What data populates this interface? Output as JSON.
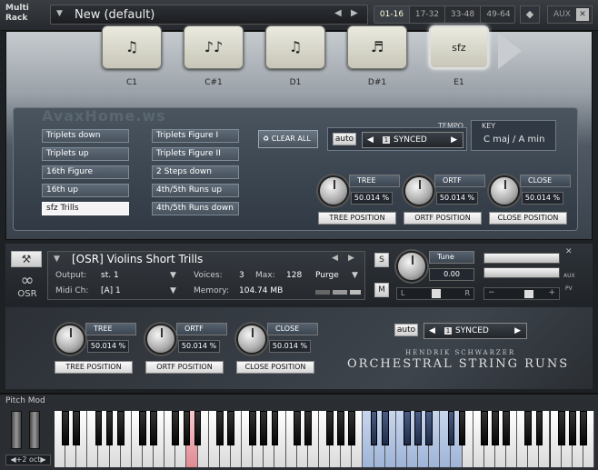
{
  "header": {
    "multi_rack": "Multi Rack",
    "preset_name": "New (default)",
    "tabs": [
      "01-16",
      "17-32",
      "33-48",
      "49-64"
    ],
    "active_tab": "01-16",
    "aux_label": "AUX"
  },
  "pads": [
    {
      "note": "C1",
      "symbol": "♫"
    },
    {
      "note": "C#1",
      "symbol": "♪♪"
    },
    {
      "note": "D1",
      "symbol": "♫"
    },
    {
      "note": "D#1",
      "symbol": "♬"
    },
    {
      "note": "E1",
      "symbol": "sfz"
    }
  ],
  "watermark": "AvaxHome.ws",
  "articulations": {
    "left": [
      "Triplets down",
      "Triplets up",
      "16th Figure",
      "16th up",
      "sfz Trills"
    ],
    "right": [
      "Triplets Figure I",
      "Triplets Figure II",
      "2 Steps down",
      "4th/5th Runs up",
      "4th/5th Runs down"
    ],
    "selected": "sfz Trills"
  },
  "clear_all": "CLEAR ALL",
  "tempo": {
    "label": "TEMPO",
    "auto": "auto",
    "sync_index": "1",
    "sync_value": "SYNCED"
  },
  "key": {
    "label": "KEY",
    "value": "C maj / A min"
  },
  "upper_mix": [
    {
      "name": "TREE",
      "value": "50.014 %",
      "button": "TREE POSITION"
    },
    {
      "name": "ORTF",
      "value": "50.014 %",
      "button": "ORTF POSITION"
    },
    {
      "name": "CLOSE",
      "value": "50.014 %",
      "button": "CLOSE POSITION"
    }
  ],
  "instrument": {
    "name": "[OSR] Violins Short Trills",
    "output_label": "Output:",
    "output_value": "st. 1",
    "voices_label": "Voices:",
    "voices_value": "3",
    "max_label": "Max:",
    "max_value": "128",
    "purge": "Purge",
    "midi_label": "Midi Ch:",
    "midi_value": "[A]  1",
    "memory_label": "Memory:",
    "memory_value": "104.74 MB",
    "solo": "S",
    "mute": "M",
    "tune_label": "Tune",
    "tune_value": "0.00",
    "pan_l": "L",
    "pan_r": "R",
    "aux": "AUX",
    "pv": "PV",
    "logo": "OSR"
  },
  "lower_mix": [
    {
      "name": "TREE",
      "value": "50.014 %",
      "button": "TREE POSITION"
    },
    {
      "name": "ORTF",
      "value": "50.014 %",
      "button": "ORTF POSITION"
    },
    {
      "name": "CLOSE",
      "value": "50.014 %",
      "button": "CLOSE POSITION"
    }
  ],
  "lower_sync": {
    "auto": "auto",
    "sync_index": "1",
    "sync_value": "SYNCED"
  },
  "brand": {
    "author": "HENDRIK SCHWARZER",
    "title": "ORCHESTRAL STRING RUNS"
  },
  "keyboard": {
    "pitch_mod": "Pitch Mod",
    "octave": "+2 oct"
  }
}
